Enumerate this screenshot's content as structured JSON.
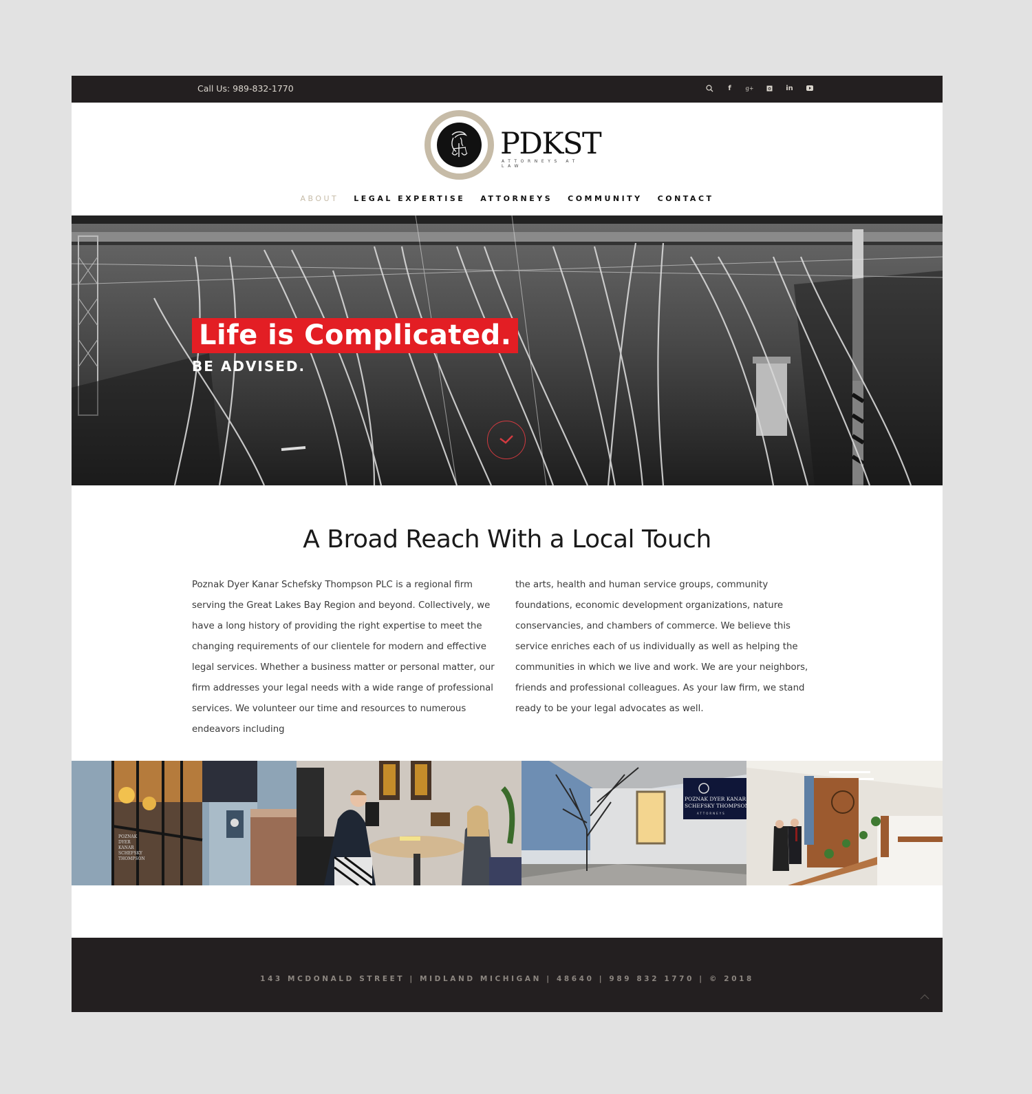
{
  "topbar": {
    "call_label": "Call Us: 989-832-1770",
    "social_icons": [
      "search-icon",
      "facebook-icon",
      "google-plus-icon",
      "instagram-icon",
      "linkedin-icon",
      "youtube-icon"
    ],
    "facebook_glyph": "f",
    "google_glyph": "g+",
    "linkedin_glyph": "in"
  },
  "logo": {
    "name": "PDKST",
    "tagline": "ATTORNEYS AT LAW",
    "ring_color": "#c6bba7"
  },
  "nav": {
    "items": [
      {
        "label": "ABOUT",
        "active": true
      },
      {
        "label": "LEGAL EXPERTISE",
        "active": false
      },
      {
        "label": "ATTORNEYS",
        "active": false
      },
      {
        "label": "COMMUNITY",
        "active": false
      },
      {
        "label": "CONTACT",
        "active": false
      }
    ],
    "active_color": "#c6bba7"
  },
  "hero": {
    "title": "Life is Complicated.",
    "subtitle": "BE ADVISED.",
    "accent_color": "#e31e24"
  },
  "about": {
    "heading": "A Broad Reach With a Local Touch",
    "left_paragraph": "Poznak Dyer Kanar Schefsky Thompson PLC is a regional firm serving the Great Lakes Bay Region and beyond. Collectively, we have a long history of providing the right expertise to meet the changing requirements of our clientele for modern and effective legal services. Whether a business matter or personal matter, our firm addresses your legal needs with a wide range of professional services. We volunteer our time and resources to numerous endeavors including",
    "right_paragraph": "the arts, health and human service groups, community foundations, economic development organizations, nature conservancies, and chambers of commerce. We believe this service enriches each of us individually as well as helping the communities in which we live and work. We are your neighbors, friends and professional colleagues. As your law firm, we stand ready to be your legal advocates as well."
  },
  "photos": [
    {
      "name": "office-entrance-photo",
      "sign_text": "POZNAK DYER KANAR SCHEFSKY THOMPSON"
    },
    {
      "name": "attorney-meeting-photo"
    },
    {
      "name": "building-exterior-photo",
      "sign_text": "POZNAK DYER KANAR SCHEFSKY THOMPSON ATTORNEYS"
    },
    {
      "name": "office-interior-photo"
    }
  ],
  "footer": {
    "address": "143 MCDONALD STREET | MIDLAND MICHIGAN | 48640 | 989 832 1770 | © 2018"
  }
}
